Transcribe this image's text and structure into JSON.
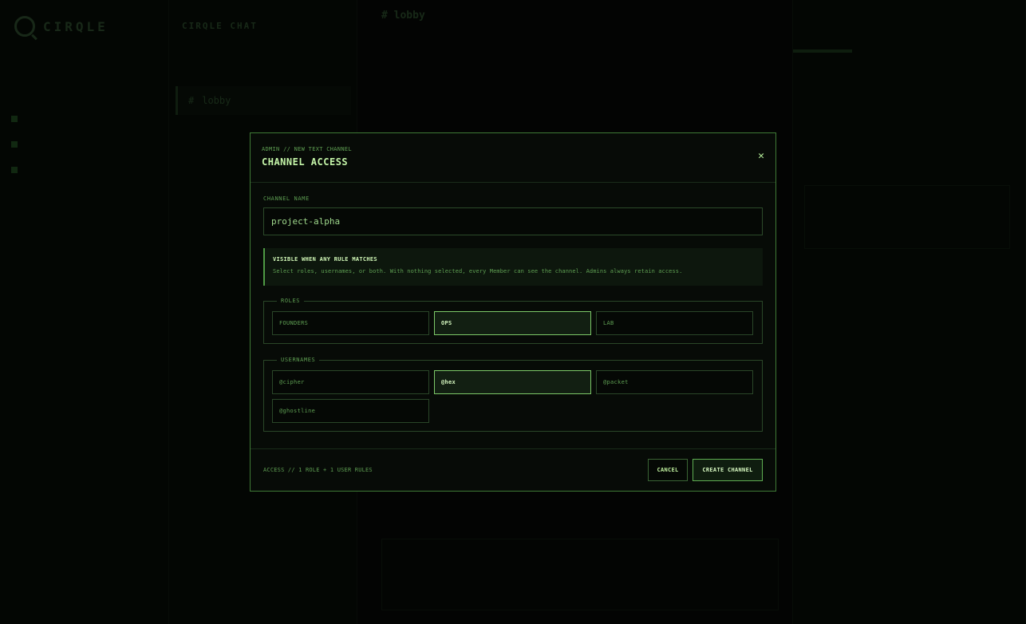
{
  "background": {
    "brand": "CIRQLE",
    "server_header": "CIRQLE CHAT",
    "channel_active": "lobby",
    "main_title": "lobby"
  },
  "modal": {
    "breadcrumb": "ADMIN // NEW TEXT CHANNEL",
    "title": "CHANNEL ACCESS",
    "close_icon": "close-icon",
    "channel_name_label": "CHANNEL NAME",
    "channel_name_value": "project-alpha",
    "notice_title": "VISIBLE WHEN ANY RULE MATCHES",
    "notice_text": "Select roles, usernames, or both. With nothing selected, every Member can see the channel. Admins always retain access.",
    "roles_legend": "ROLES",
    "roles": [
      {
        "label": "FOUNDERS",
        "selected": false
      },
      {
        "label": "OPS",
        "selected": true
      },
      {
        "label": "LAB",
        "selected": false
      }
    ],
    "usernames_legend": "USERNAMES",
    "usernames": [
      {
        "label": "@cipher",
        "selected": false
      },
      {
        "label": "@hex",
        "selected": true
      },
      {
        "label": "@packet",
        "selected": false
      },
      {
        "label": "@ghostline",
        "selected": false
      }
    ],
    "status": "ACCESS // 1 ROLE + 1 USER RULES",
    "cancel_label": "CANCEL",
    "create_label": "CREATE CHANNEL"
  },
  "colors": {
    "accent": "#7cc968",
    "border": "#3f7a36",
    "background": "#070b07"
  }
}
